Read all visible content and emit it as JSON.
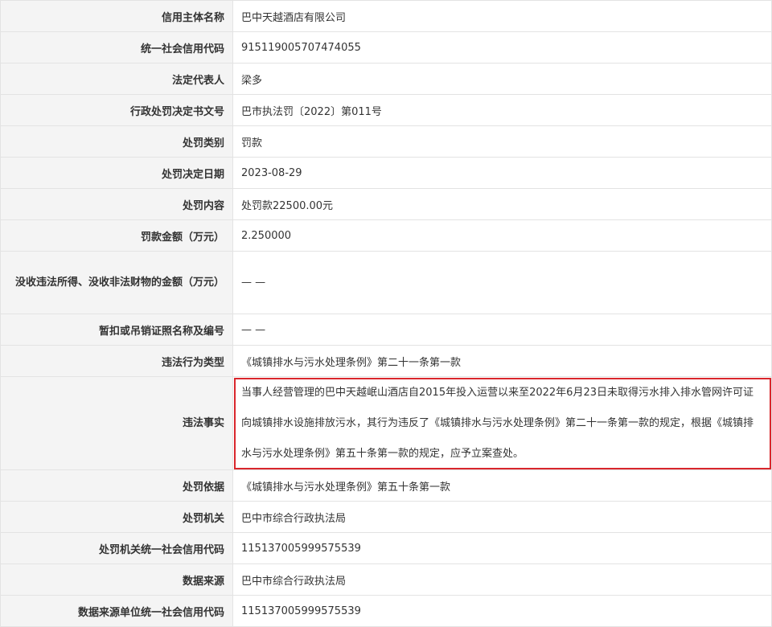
{
  "rows": [
    {
      "label": "信用主体名称",
      "value": "巴中天越酒店有限公司"
    },
    {
      "label": "统一社会信用代码",
      "value": "915119005707474055"
    },
    {
      "label": "法定代表人",
      "value": "梁多"
    },
    {
      "label": "行政处罚决定书文号",
      "value": "巴市执法罚〔2022〕第011号"
    },
    {
      "label": "处罚类别",
      "value": "罚款"
    },
    {
      "label": "处罚决定日期",
      "value": "2023-08-29"
    },
    {
      "label": "处罚内容",
      "value": "处罚款22500.00元"
    },
    {
      "label": "罚款金额（万元）",
      "value": "2.250000"
    },
    {
      "label": "没收违法所得、没收非法财物的金额（万元）",
      "value": "— —"
    },
    {
      "label": "暂扣或吊销证照名称及编号",
      "value": "— —"
    },
    {
      "label": "违法行为类型",
      "value": "《城镇排水与污水处理条例》第二十一条第一款"
    },
    {
      "label": "违法事实",
      "value": "当事人经营管理的巴中天越岷山酒店自2015年投入运营以来至2022年6月23日未取得污水排入排水管网许可证向城镇排水设施排放污水，其行为违反了《城镇排水与污水处理条例》第二十一条第一款的规定，根据《城镇排水与污水处理条例》第五十条第一款的规定，应予立案查处。"
    },
    {
      "label": "处罚依据",
      "value": "《城镇排水与污水处理条例》第五十条第一款"
    },
    {
      "label": "处罚机关",
      "value": "巴中市综合行政执法局"
    },
    {
      "label": "处罚机关统一社会信用代码",
      "value": "115137005999575539"
    },
    {
      "label": "数据来源",
      "value": "巴中市综合行政执法局"
    },
    {
      "label": "数据来源单位统一社会信用代码",
      "value": "115137005999575539"
    }
  ],
  "highlight_color": "#d9262c"
}
